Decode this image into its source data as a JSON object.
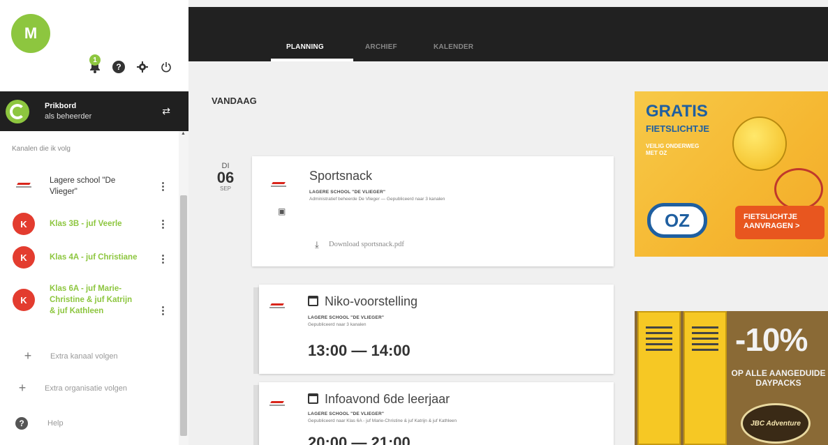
{
  "user": {
    "initial": "M"
  },
  "notifications": {
    "count": "1"
  },
  "prikbord": {
    "title": "Prikbord",
    "subtitle": "als beheerder"
  },
  "sidebar": {
    "follow_label": "Kanalen die ik volg",
    "channels": [
      {
        "name": "Lagere school \"De Vlieger\"",
        "badge": ""
      },
      {
        "name": "Klas 3B - juf Veerle",
        "badge": "K"
      },
      {
        "name": "Klas 4A - juf Christiane",
        "badge": "K"
      },
      {
        "name": "Klas 6A - juf Marie-Christine & juf Katrijn & juf Kathleen",
        "badge": "K"
      }
    ],
    "add_channel": "Extra kanaal volgen",
    "add_org": "Extra organisatie volgen",
    "help": "Help"
  },
  "tabs": {
    "planning": "PLANNING",
    "archief": "ARCHIEF",
    "kalender": "KALENDER"
  },
  "main": {
    "section_title": "VANDAAG",
    "date": {
      "dow": "DI",
      "day": "06",
      "month": "SEP"
    },
    "posts": [
      {
        "title": "Sportsnack",
        "school": "LAGERE SCHOOL \"DE VLIEGER\"",
        "meta": "Administratief beheerde De Vlieger — Gepubliceerd naar 3 kanalen",
        "download": "Download sportsnack.pdf"
      },
      {
        "title": "Niko-voorstelling",
        "school": "LAGERE SCHOOL \"DE VLIEGER\"",
        "meta": "Gepubliceerd naar 3 kanalen",
        "time": "13:00 — 14:00"
      },
      {
        "title": "Infoavond 6de leerjaar",
        "school": "LAGERE SCHOOL \"DE VLIEGER\"",
        "meta": "Gepubliceerd naar Klas 6A - juf Marie-Christine & juf Katrijn & juf Kathleen",
        "time": "20:00 — 21:00"
      }
    ]
  },
  "ads": {
    "ad1": {
      "headline": "GRATIS",
      "subhead": "FIETSLICHTJE",
      "small": "VEILIG ONDERWEG MET OZ",
      "logo": "OZ",
      "cta": "FIETSLICHTJE AANVRAGEN >"
    },
    "ad2": {
      "percent": "-10%",
      "text": "OP ALLE AANGEDUIDE DAYPACKS",
      "brand": "JBC Adventure"
    }
  }
}
